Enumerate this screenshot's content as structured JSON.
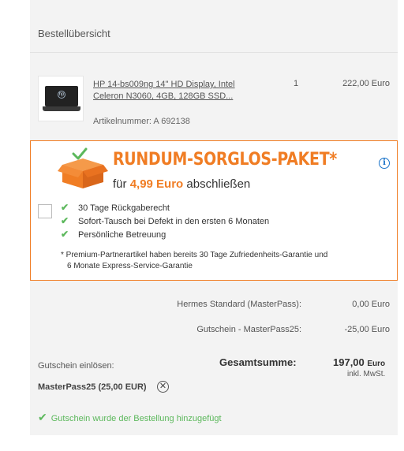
{
  "header": {
    "title": "Bestellübersicht"
  },
  "product": {
    "name": "HP 14-bs009ng 14\" HD Display, Intel Celeron N3060, 4GB, 128GB SSD...",
    "quantity": "1",
    "price": "222,00 Euro",
    "article_number": "Artikelnummer: A 692138",
    "thumbnail_icon": "laptop-thumbnail"
  },
  "promo": {
    "title": "RUNDUM-SORGLOS-PAKET*",
    "subtitle_prefix": "für ",
    "amount": "4,99 Euro",
    "subtitle_suffix": " abschließen",
    "features": [
      "30 Tage Rückgaberecht",
      "Sofort-Tausch bei Defekt in den ersten 6 Monaten",
      "Persönliche Betreuung"
    ],
    "footnote_line1": "* Premium-Partnerartikel haben bereits 30 Tage Zufriedenheits-Garantie und",
    "footnote_line2": "6 Monate Express-Service-Garantie",
    "accent_color": "#f07d24",
    "info_icon": "info-icon"
  },
  "summary": {
    "shipping_label": "Hermes Standard (MasterPass):",
    "shipping_value": "0,00 Euro",
    "voucher_label": "Gutschein - MasterPass25:",
    "voucher_value": "-25,00 Euro",
    "total_label": "Gesamtsumme:",
    "total_value": "197,00",
    "total_currency": "Euro",
    "vat_note": "inkl. MwSt.",
    "redeem_label": "Gutschein einlösen:",
    "voucher_code": "MasterPass25 (25,00 EUR)",
    "success_message": "Gutschein wurde der Bestellung hinzugefügt"
  }
}
